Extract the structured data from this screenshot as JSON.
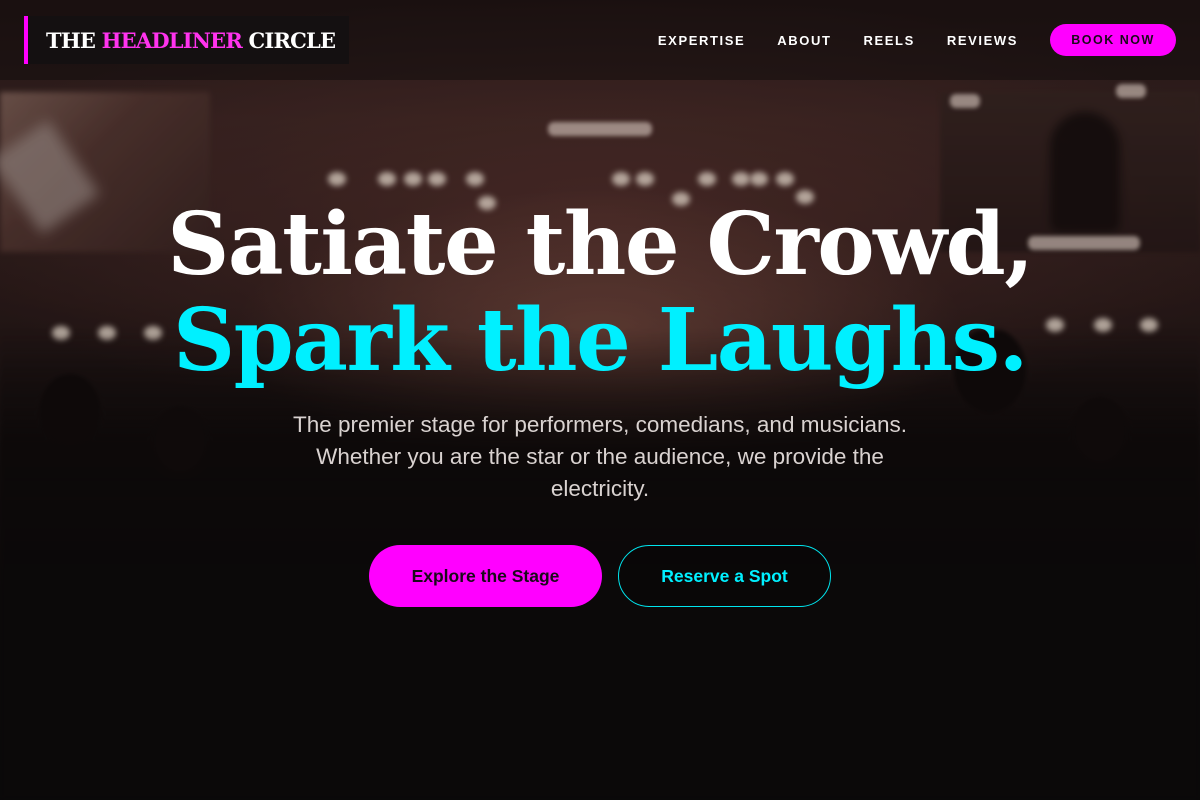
{
  "brand": {
    "logo_part1": "THE",
    "logo_part2": "HEADLINER",
    "logo_part3": "CIRCLE",
    "accent_color": "#ff00ff",
    "highlight_color": "#00f0ff"
  },
  "nav": {
    "items": [
      {
        "label": "EXPERTISE"
      },
      {
        "label": "ABOUT"
      },
      {
        "label": "REELS"
      },
      {
        "label": "REVIEWS"
      }
    ],
    "cta_label": "BOOK NOW"
  },
  "hero": {
    "headline_line1": "Satiate the Crowd,",
    "headline_line2": "Spark the Laughs.",
    "subtitle": "The premier stage for performers, comedians, and musicians. Whether you are the star or the audience, we provide the electricity.",
    "primary_cta": "Explore the Stage",
    "secondary_cta": "Reserve a Spot"
  }
}
